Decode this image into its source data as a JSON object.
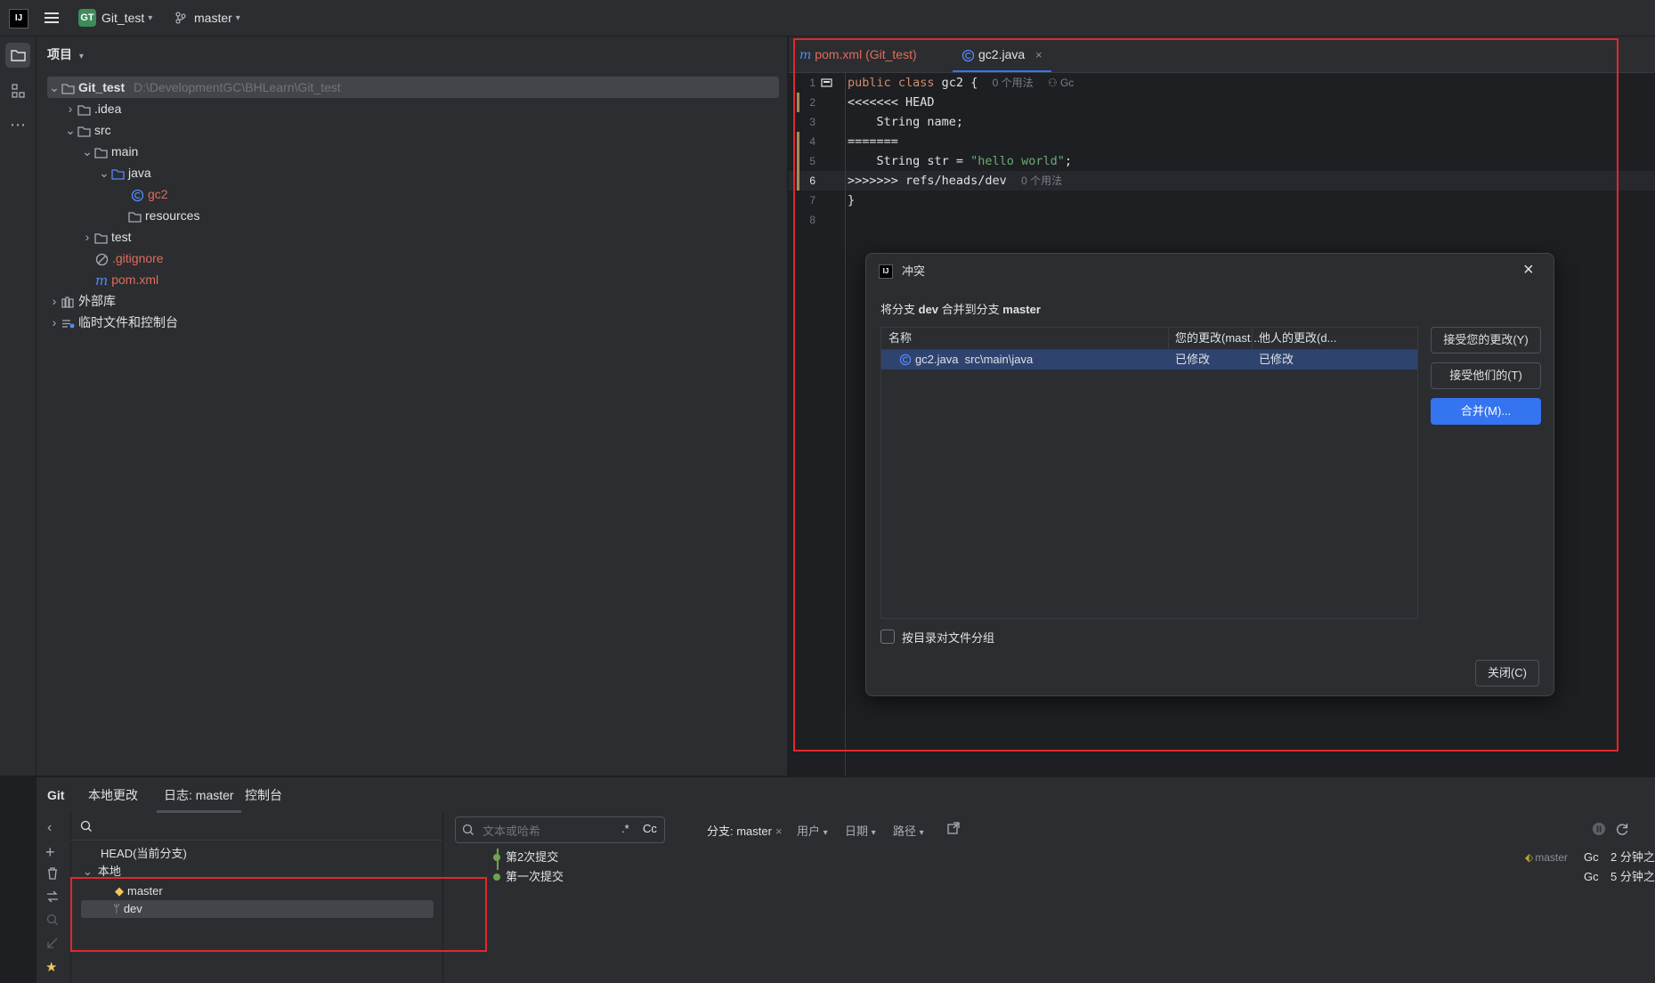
{
  "titlebar": {
    "app_icon": "intellij-icon",
    "project_badge": "GT",
    "project_name": "Git_test",
    "branch": "master"
  },
  "project_panel": {
    "title": "项目",
    "tree": [
      {
        "label": "Git_test",
        "path": "D:\\DevelopmentGC\\BHLearn\\Git_test"
      },
      {
        "label": ".idea"
      },
      {
        "label": "src"
      },
      {
        "label": "main"
      },
      {
        "label": "java"
      },
      {
        "label": "gc2"
      },
      {
        "label": "resources"
      },
      {
        "label": "test"
      },
      {
        "label": ".gitignore"
      },
      {
        "label": "pom.xml"
      },
      {
        "label": "外部库"
      },
      {
        "label": "临时文件和控制台"
      }
    ]
  },
  "editor": {
    "tabs": [
      {
        "label": "pom.xml (Git_test)"
      },
      {
        "label": "gc2.java"
      }
    ],
    "lines": [
      {
        "n": "1",
        "kw": "public class ",
        "name": "gc2",
        "rest": " {",
        "hint1": "0 个用法",
        "hint2": "Gc"
      },
      {
        "n": "2",
        "text": "<<<<<<< HEAD"
      },
      {
        "n": "3",
        "text": "    String name;"
      },
      {
        "n": "4",
        "text": "======="
      },
      {
        "n": "5",
        "pre": "    String str = ",
        "str": "\"hello world\"",
        "post": ";"
      },
      {
        "n": "6",
        "text": ">>>>>>> refs/heads/dev",
        "hint1": "0 个用法"
      },
      {
        "n": "7",
        "text": "}"
      },
      {
        "n": "8",
        "text": ""
      }
    ]
  },
  "dialog": {
    "title": "冲突",
    "desc_pre": "将分支 ",
    "desc_b1": "dev",
    "desc_mid": " 合并到分支 ",
    "desc_b2": "master",
    "columns": [
      "名称",
      "您的更改(mast...",
      "他人的更改(d..."
    ],
    "rows": [
      {
        "name": "gc2.java",
        "path": "src\\main\\java",
        "yours": "已修改",
        "theirs": "已修改"
      }
    ],
    "btn_accept_yours": "接受您的更改(Y)",
    "btn_accept_theirs": "接受他们的(T)",
    "btn_merge": "合并(M)...",
    "checkbox_label": "按目录对文件分组",
    "btn_close": "关闭(C)"
  },
  "bottom": {
    "tabs": [
      "Git",
      "本地更改",
      "日志: master",
      "控制台"
    ],
    "branches": {
      "head": "HEAD(当前分支)",
      "local": "本地",
      "items": [
        "master",
        "dev"
      ]
    },
    "log_toolbar": {
      "search_placeholder": "文本或哈希",
      "regex": ".*",
      "case": "Cc",
      "branch_filter": "分支: master",
      "user": "用户",
      "date": "日期",
      "path": "路径"
    },
    "commits": [
      {
        "msg": "第2次提交",
        "tag": "master",
        "author": "Gc",
        "time": "2 分钟之"
      },
      {
        "msg": "第一次提交",
        "author": "Gc",
        "time": "5 分钟之"
      }
    ]
  },
  "colors": {
    "accent": "#3574f0",
    "highlight_box": "#e0282e",
    "modified": "#e06c5c",
    "keyword": "#cf8e6d",
    "string": "#6aab73"
  }
}
